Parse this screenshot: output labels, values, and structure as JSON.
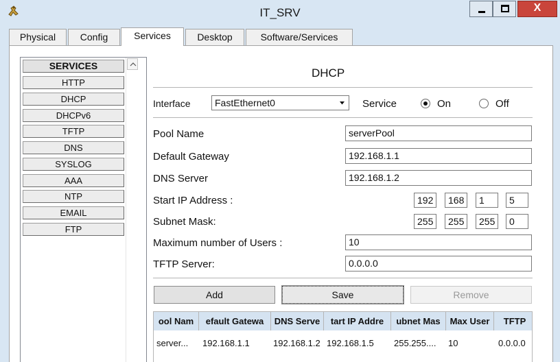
{
  "window": {
    "title": "IT_SRV",
    "close_glyph": "X"
  },
  "tabs": [
    "Physical",
    "Config",
    "Services",
    "Desktop",
    "Software/Services"
  ],
  "services": {
    "header": "SERVICES",
    "items": [
      "HTTP",
      "DHCP",
      "DHCPv6",
      "TFTP",
      "DNS",
      "SYSLOG",
      "AAA",
      "NTP",
      "EMAIL",
      "FTP"
    ]
  },
  "dhcp": {
    "title": "DHCP",
    "interface_label": "Interface",
    "interface_value": "FastEthernet0",
    "service_label": "Service",
    "on_label": "On",
    "off_label": "Off",
    "service_on": true,
    "fields": {
      "pool_name": {
        "label": "Pool Name",
        "value": "serverPool"
      },
      "default_gateway": {
        "label": "Default Gateway",
        "value": "192.168.1.1"
      },
      "dns_server": {
        "label": "DNS Server",
        "value": "192.168.1.2"
      },
      "start_ip": {
        "label": "Start IP Address :",
        "octets": [
          "192",
          "168",
          "1",
          "5"
        ]
      },
      "subnet_mask": {
        "label": "Subnet Mask:",
        "octets": [
          "255",
          "255",
          "255",
          "0"
        ]
      },
      "max_users": {
        "label": "Maximum number of Users :",
        "value": "10"
      },
      "tftp_server": {
        "label": "TFTP Server:",
        "value": "0.0.0.0"
      }
    },
    "buttons": {
      "add": "Add",
      "save": "Save",
      "remove": "Remove"
    },
    "table": {
      "headers": [
        "ool Nam",
        "efault Gatewa",
        "DNS Serve",
        "tart IP Addre",
        "ubnet Mas",
        "Max User",
        "TFTP"
      ],
      "rows": [
        [
          "server...",
          "192.168.1.1",
          "192.168.1.2",
          "192.168.1.5",
          "255.255....",
          "10",
          "0.0.0.0"
        ]
      ]
    }
  },
  "colors": {
    "frame": "#d8e6f3",
    "close": "#c9453b",
    "table_header": "#d5e3f1"
  }
}
